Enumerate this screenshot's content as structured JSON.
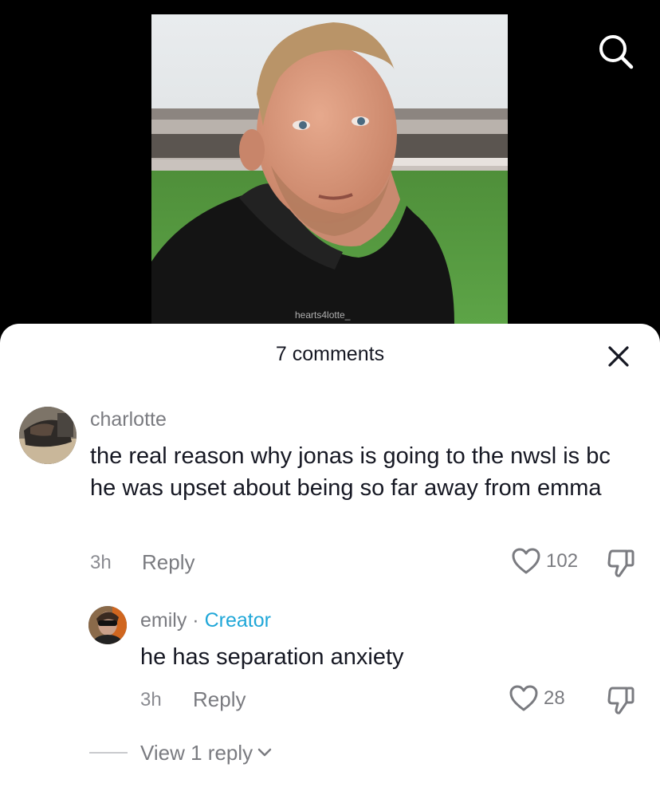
{
  "video": {
    "watermark": "hearts4lotte_"
  },
  "header": {
    "comments_count": "7 comments"
  },
  "comments": [
    {
      "username": "charlotte",
      "text": "the real reason why jonas is going to the nwsl is bc he was upset about being so far away from emma",
      "time": "3h",
      "reply_label": "Reply",
      "likes": "102"
    },
    {
      "username": "emily",
      "separator": " · ",
      "badge": "Creator",
      "text": "he has separation anxiety",
      "time": "3h",
      "reply_label": "Reply",
      "likes": "28"
    }
  ],
  "view_replies": {
    "label": "View 1 reply"
  },
  "colors": {
    "creator_badge": "#20a7d8",
    "text_primary": "#161823",
    "text_secondary": "#7a7b80"
  }
}
